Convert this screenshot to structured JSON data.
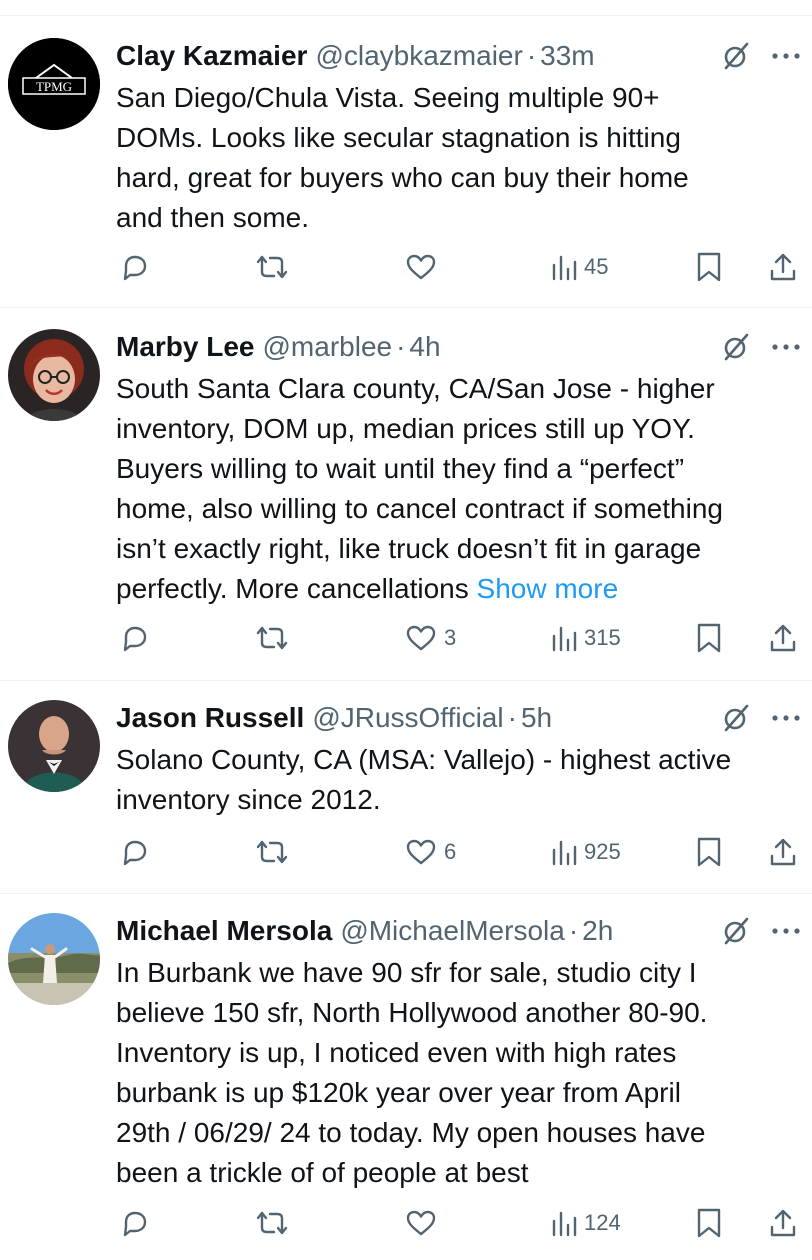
{
  "tweets": [
    {
      "name": "Clay Kazmaier",
      "handle": "@claybkazmaier",
      "separator": "·",
      "time": "33m",
      "avatar_text": "TPMG",
      "lines": [
        "San Diego/Chula Vista. Seeing multiple 90+",
        "DOMs. Looks like secular stagnation is hitting",
        "hard, great for buyers who can buy their home",
        "and then some."
      ],
      "show_more": "",
      "replies": "",
      "reposts": "",
      "likes": "",
      "views": "45"
    },
    {
      "name": "Marby Lee",
      "handle": "@marblee",
      "separator": "·",
      "time": "4h",
      "lines": [
        "South Santa Clara county, CA/San Jose - higher",
        "inventory, DOM up, median prices still up YOY.",
        "Buyers willing to wait until they find a “perfect”",
        "home, also willing to cancel contract if something",
        "isn’t exactly right, like truck doesn’t fit in garage",
        "perfectly. More cancellations"
      ],
      "show_more": "Show more",
      "replies": "",
      "reposts": "",
      "likes": "3",
      "views": "315"
    },
    {
      "name": "Jason Russell",
      "handle": "@JRussOfficial",
      "separator": "·",
      "time": "5h",
      "lines": [
        "Solano County, CA (MSA: Vallejo) - highest active",
        "inventory since 2012."
      ],
      "show_more": "",
      "replies": "",
      "reposts": "",
      "likes": "6",
      "views": "925"
    },
    {
      "name": "Michael Mersola",
      "handle": "@MichaelMersola",
      "separator": "·",
      "time": "2h",
      "lines": [
        "In Burbank we have 90 sfr for sale, studio city I",
        "believe 150 sfr, North Hollywood another 80-90.",
        "Inventory is up, I noticed even with high rates",
        "burbank is up $120k year over year from April",
        "29th / 06/29/ 24 to today. My open houses have",
        "been a trickle of of people at best"
      ],
      "show_more": "",
      "replies": "",
      "reposts": "",
      "likes": "",
      "views": "124"
    }
  ],
  "icons": {
    "reply": "reply-icon",
    "repost": "repost-icon",
    "like": "heart-icon",
    "views": "views-icon",
    "bookmark": "bookmark-icon",
    "share": "share-icon",
    "grok": "grok-icon",
    "more": "more-dots-icon"
  },
  "colors": {
    "text": "#0f1419",
    "secondary": "#536471",
    "link": "#1d9bf0",
    "divider": "#eff3f4"
  }
}
